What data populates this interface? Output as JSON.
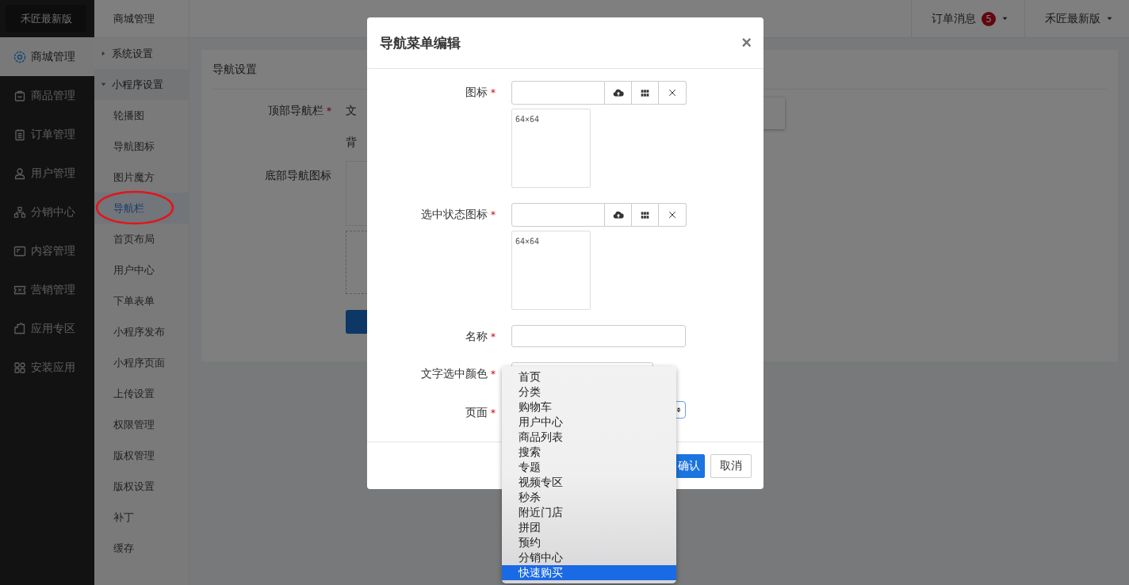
{
  "sidebar": {
    "logo": "禾匠最新版",
    "items": [
      {
        "label": "商城管理",
        "selected": true
      },
      {
        "label": "商品管理",
        "selected": false
      },
      {
        "label": "订单管理",
        "selected": false
      },
      {
        "label": "用户管理",
        "selected": false
      },
      {
        "label": "分销中心",
        "selected": false
      },
      {
        "label": "内容管理",
        "selected": false
      },
      {
        "label": "营销管理",
        "selected": false
      },
      {
        "label": "应用专区",
        "selected": false
      },
      {
        "label": "安装应用",
        "selected": false
      }
    ]
  },
  "subnav": {
    "title": "商城管理",
    "items": [
      {
        "label": "系统设置",
        "expanded": false
      },
      {
        "label": "小程序设置",
        "expanded": true,
        "children": [
          {
            "label": "轮播图",
            "selected": false
          },
          {
            "label": "导航图标",
            "selected": false
          },
          {
            "label": "图片魔方",
            "selected": false
          },
          {
            "label": "导航栏",
            "selected": true
          },
          {
            "label": "首页布局",
            "selected": false
          },
          {
            "label": "用户中心",
            "selected": false
          },
          {
            "label": "下单表单",
            "selected": false
          },
          {
            "label": "小程序发布",
            "selected": false
          },
          {
            "label": "小程序页面",
            "selected": false
          }
        ]
      },
      {
        "label": "上传设置"
      },
      {
        "label": "权限管理"
      },
      {
        "label": "版权管理"
      },
      {
        "label": "版权设置"
      },
      {
        "label": "补丁"
      },
      {
        "label": "缓存"
      }
    ]
  },
  "header": {
    "messages": "订单消息",
    "badge": "5",
    "user": "禾匠最新版"
  },
  "page": {
    "title": "导航设置",
    "required_mark": "*",
    "fields": [
      {
        "label": "顶部导航栏",
        "required": true,
        "lines": [
          "文",
          "背"
        ]
      },
      {
        "label": "底部导航图标",
        "required": false
      }
    ]
  },
  "modal": {
    "title": "导航菜单编辑",
    "close": "×",
    "required_mark": "*",
    "fields": [
      {
        "kind": "image",
        "label": "图标",
        "required": true,
        "hint": "64×64"
      },
      {
        "kind": "image",
        "label": "选中状态图标",
        "required": true,
        "hint": "64×64"
      },
      {
        "kind": "text",
        "label": "名称",
        "required": true
      },
      {
        "kind": "color",
        "label": "文字选中颜色",
        "required": true
      },
      {
        "kind": "select",
        "label": "页面",
        "required": true
      }
    ],
    "buttons": [
      {
        "label": "确认",
        "primary": true
      },
      {
        "label": "取消",
        "primary": false
      }
    ]
  },
  "dropdown": {
    "options": [
      {
        "label": "首页",
        "selected": false
      },
      {
        "label": "分类",
        "selected": false
      },
      {
        "label": "购物车",
        "selected": false
      },
      {
        "label": "用户中心",
        "selected": false
      },
      {
        "label": "商品列表",
        "selected": false
      },
      {
        "label": "搜索",
        "selected": false
      },
      {
        "label": "专题",
        "selected": false
      },
      {
        "label": "视频专区",
        "selected": false
      },
      {
        "label": "秒杀",
        "selected": false
      },
      {
        "label": "附近门店",
        "selected": false
      },
      {
        "label": "拼团",
        "selected": false
      },
      {
        "label": "预约",
        "selected": false
      },
      {
        "label": "分销中心",
        "selected": false
      },
      {
        "label": "快速购买",
        "selected": true
      }
    ]
  }
}
